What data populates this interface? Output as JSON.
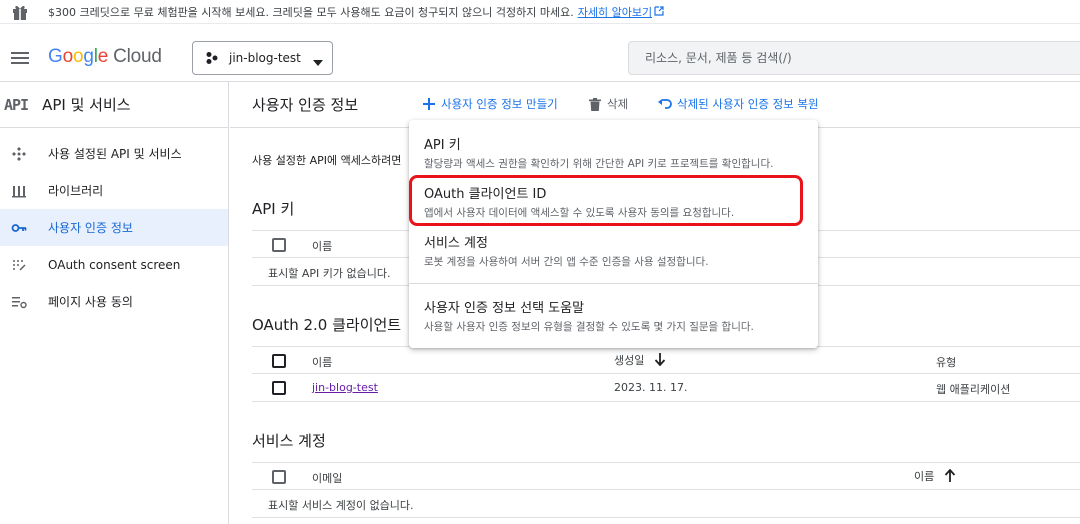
{
  "banner": {
    "message": "$300 크레딧으로 무료 체험판을 시작해 보세요. 크레딧을 모두 사용해도 요금이 청구되지 않으니 걱정하지 마세요.",
    "link": "자세히 알아보기",
    "icons": [
      "gift-icon",
      "external-link-icon"
    ]
  },
  "header": {
    "logo_google": [
      "G",
      "o",
      "o",
      "g",
      "l",
      "e"
    ],
    "logo_cloud": "Cloud",
    "project_name": "jin-blog-test",
    "search_placeholder": "리소스, 문서, 제품 등 검색(/)"
  },
  "sidebar": {
    "badge": "API",
    "title": "API 및 서비스",
    "items": [
      {
        "label": "사용 설정된 API 및 서비스",
        "icon": "enabled-apis-icon"
      },
      {
        "label": "라이브러리",
        "icon": "library-icon"
      },
      {
        "label": "사용자 인증 정보",
        "icon": "key-icon",
        "active": true
      },
      {
        "label": "OAuth consent screen",
        "icon": "consent-icon"
      },
      {
        "label": "페이지 사용 동의",
        "icon": "page-agreement-icon"
      }
    ]
  },
  "toolbar": {
    "title": "사용자 인증 정보",
    "create": "사용자 인증 정보 만들기",
    "delete": "삭제",
    "restore": "삭제된 사용자 인증 정보 복원"
  },
  "main": {
    "intro": "사용 설정한 API에 액세스하려면",
    "api_keys": {
      "title": "API 키",
      "col_name": "이름",
      "empty": "표시할 API 키가 없습니다."
    },
    "oauth": {
      "title": "OAuth 2.0 클라이언트",
      "col_name": "이름",
      "col_created": "생성일",
      "col_type": "유형",
      "rows": [
        {
          "name": "jin-blog-test",
          "created": "2023. 11. 17.",
          "type": "웹 애플리케이션"
        }
      ]
    },
    "service_accounts": {
      "title": "서비스 계정",
      "col_email": "이메일",
      "col_name": "이름",
      "empty": "표시할 서비스 계정이 없습니다."
    }
  },
  "menu": {
    "items": [
      {
        "title": "API 키",
        "desc": "할당량과 액세스 권한을 확인하기 위해 간단한 API 키로 프로젝트를 확인합니다."
      },
      {
        "title": "OAuth 클라이언트 ID",
        "desc": "앱에서 사용자 데이터에 액세스할 수 있도록 사용자 동의를 요청합니다."
      },
      {
        "title": "서비스 계정",
        "desc": "로봇 계정을 사용하여 서버 간의 앱 수준 인증을 사용 설정합니다."
      },
      {
        "title": "사용자 인증 정보 선택 도움말",
        "desc": "사용할 사용자 인증 정보의 유형을 결정할 수 있도록 몇 가지 질문을 합니다."
      }
    ]
  },
  "colors": {
    "accent": "#1a73e8",
    "highlight": "#e8141a",
    "active_bg": "#e8f0fe"
  }
}
